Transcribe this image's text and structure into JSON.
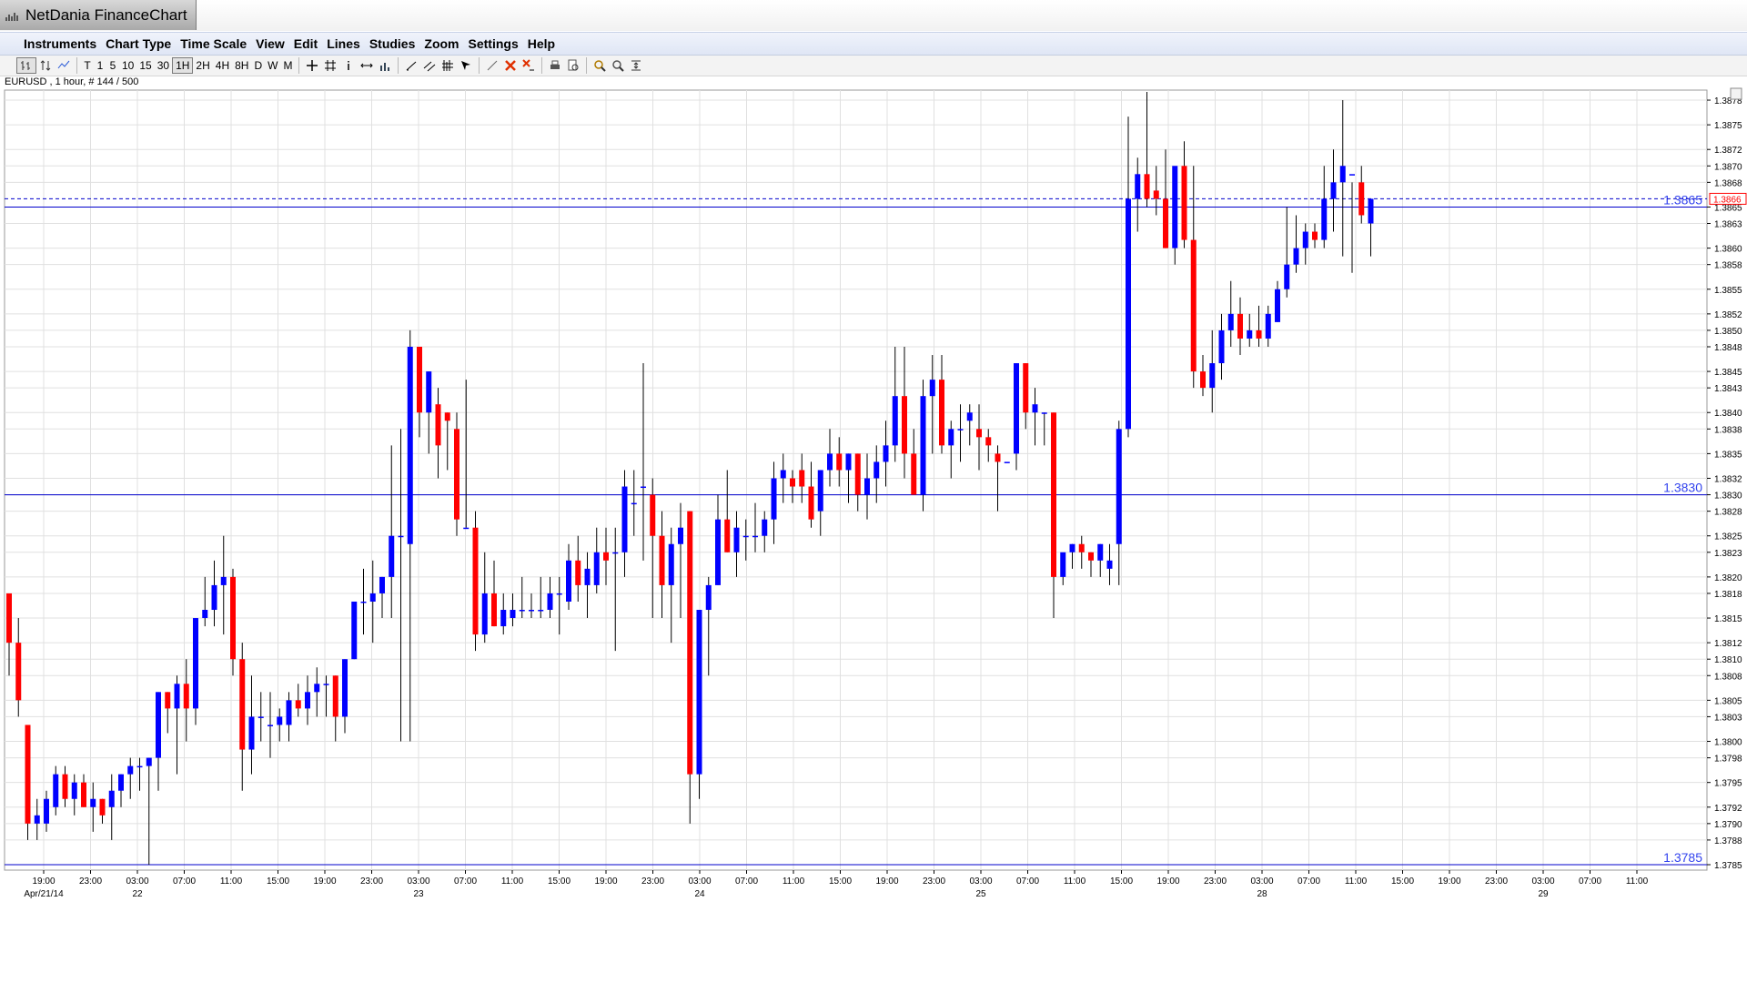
{
  "window": {
    "title": "NetDania FinanceChart"
  },
  "menu": [
    "Instruments",
    "Chart Type",
    "Time Scale",
    "View",
    "Edit",
    "Lines",
    "Studies",
    "Zoom",
    "Settings",
    "Help"
  ],
  "toolbar": {
    "timescales": [
      "T",
      "1",
      "5",
      "10",
      "15",
      "30",
      "1H",
      "2H",
      "4H",
      "8H",
      "D",
      "W",
      "M"
    ],
    "selected_timescale": "1H",
    "icons": [
      "bar-chart-icon",
      "sort-icon",
      "line-chart-icon",
      "crosshair-icon",
      "grid-icon",
      "info-icon",
      "pan-icon",
      "volume-icon",
      "trendline-icon",
      "trend-channel-icon",
      "fibonacci-icon",
      "arrow-cursor-icon",
      "draw-line-icon",
      "delete-icon",
      "delete-all-icon",
      "print-icon",
      "print-preview-icon",
      "zoom-in-icon",
      "zoom-out-icon",
      "zoom-fit-icon"
    ]
  },
  "chart_caption": "EURUSD , 1 hour, # 144 / 500",
  "colors": {
    "bull": "#0000ff",
    "bear": "#ff0000",
    "wick": "#000000",
    "grid": "#e0e0e0",
    "hline": "#0000cc",
    "dashed": "#0000cc",
    "price_box": "#ff0000"
  },
  "chart_data": {
    "type": "candlestick",
    "symbol": "EURUSD",
    "interval": "1 hour",
    "ylim": [
      1.3785,
      1.388
    ],
    "y_ticks": [
      "1.3878",
      "1.3875",
      "1.3872",
      "1.3870",
      "1.3868",
      "1.3865",
      "1.3863",
      "1.3860",
      "1.3858",
      "1.3855",
      "1.3852",
      "1.3850",
      "1.3848",
      "1.3845",
      "1.3843",
      "1.3840",
      "1.3838",
      "1.3835",
      "1.3832",
      "1.3830",
      "1.3828",
      "1.3825",
      "1.3823",
      "1.3820",
      "1.3818",
      "1.3815",
      "1.3812",
      "1.3810",
      "1.3808",
      "1.3805",
      "1.3803",
      "1.3800",
      "1.3798",
      "1.3795",
      "1.3792",
      "1.3790",
      "1.3788",
      "1.3785"
    ],
    "x_time_labels": [
      "19:00",
      "23:00",
      "03:00",
      "07:00",
      "11:00",
      "15:00",
      "19:00",
      "23:00",
      "03:00",
      "07:00",
      "11:00",
      "15:00",
      "19:00",
      "23:00",
      "03:00",
      "07:00",
      "11:00",
      "15:00",
      "19:00",
      "23:00",
      "03:00",
      "07:00",
      "11:00",
      "15:00",
      "19:00",
      "23:00",
      "03:00",
      "07:00",
      "11:00",
      "15:00",
      "19:00",
      "23:00",
      "03:00",
      "07:00",
      "11:00"
    ],
    "x_date_labels": [
      {
        "label": "Apr/21/14",
        "at_time_index": 0
      },
      {
        "label": "22",
        "at_time_index": 2
      },
      {
        "label": "23",
        "at_time_index": 8
      },
      {
        "label": "24",
        "at_time_index": 14
      },
      {
        "label": "25",
        "at_time_index": 20
      },
      {
        "label": "28",
        "at_time_index": 26
      },
      {
        "label": "29",
        "at_time_index": 32
      }
    ],
    "horizontal_lines": [
      {
        "label": "1.3865",
        "value": 1.3865
      },
      {
        "label": "1.3830",
        "value": 1.383
      },
      {
        "label": "1.3785",
        "value": 1.3785
      }
    ],
    "current_price": {
      "label": "1.3866",
      "value": 1.3866
    },
    "candles": [
      [
        1.3818,
        1.3818,
        1.3808,
        1.3812
      ],
      [
        1.3812,
        1.3815,
        1.3803,
        1.3805
      ],
      [
        1.3802,
        1.3802,
        1.3788,
        1.379
      ],
      [
        1.379,
        1.3793,
        1.3788,
        1.3791
      ],
      [
        1.379,
        1.3794,
        1.3789,
        1.3793
      ],
      [
        1.3792,
        1.3797,
        1.3791,
        1.3796
      ],
      [
        1.3796,
        1.3797,
        1.3792,
        1.3793
      ],
      [
        1.3793,
        1.3796,
        1.3791,
        1.3795
      ],
      [
        1.3795,
        1.3796,
        1.3792,
        1.3792
      ],
      [
        1.3792,
        1.3795,
        1.3789,
        1.3793
      ],
      [
        1.3793,
        1.3793,
        1.379,
        1.3791
      ],
      [
        1.3792,
        1.3796,
        1.3788,
        1.3794
      ],
      [
        1.3794,
        1.3796,
        1.3792,
        1.3796
      ],
      [
        1.3796,
        1.3798,
        1.3793,
        1.3797
      ],
      [
        1.3797,
        1.3798,
        1.3794,
        1.3797
      ],
      [
        1.3797,
        1.3798,
        1.3785,
        1.3798
      ],
      [
        1.3798,
        1.3806,
        1.3794,
        1.3806
      ],
      [
        1.3806,
        1.3806,
        1.3801,
        1.3804
      ],
      [
        1.3804,
        1.3808,
        1.3796,
        1.3807
      ],
      [
        1.3807,
        1.381,
        1.38,
        1.3804
      ],
      [
        1.3804,
        1.3815,
        1.3802,
        1.3815
      ],
      [
        1.3815,
        1.382,
        1.3814,
        1.3816
      ],
      [
        1.3816,
        1.3822,
        1.3814,
        1.3819
      ],
      [
        1.3819,
        1.3825,
        1.3813,
        1.382
      ],
      [
        1.382,
        1.3821,
        1.3808,
        1.381
      ],
      [
        1.381,
        1.3812,
        1.3794,
        1.3799
      ],
      [
        1.3799,
        1.3808,
        1.3796,
        1.3803
      ],
      [
        1.3803,
        1.3806,
        1.38,
        1.3803
      ],
      [
        1.3802,
        1.3806,
        1.3798,
        1.3802
      ],
      [
        1.3802,
        1.3804,
        1.38,
        1.3803
      ],
      [
        1.3802,
        1.3806,
        1.38,
        1.3805
      ],
      [
        1.3805,
        1.3807,
        1.3803,
        1.3804
      ],
      [
        1.3804,
        1.3808,
        1.3802,
        1.3806
      ],
      [
        1.3806,
        1.3809,
        1.3803,
        1.3807
      ],
      [
        1.3807,
        1.3808,
        1.3803,
        1.3807
      ],
      [
        1.3808,
        1.3808,
        1.38,
        1.3803
      ],
      [
        1.3803,
        1.381,
        1.3801,
        1.381
      ],
      [
        1.381,
        1.3816,
        1.381,
        1.3817
      ],
      [
        1.3817,
        1.3821,
        1.3813,
        1.3817
      ],
      [
        1.3817,
        1.3822,
        1.3812,
        1.3818
      ],
      [
        1.3818,
        1.382,
        1.3815,
        1.382
      ],
      [
        1.382,
        1.3836,
        1.3815,
        1.3825
      ],
      [
        1.3825,
        1.3838,
        1.38,
        1.3825
      ],
      [
        1.3824,
        1.385,
        1.38,
        1.3848
      ],
      [
        1.3848,
        1.3847,
        1.3837,
        1.384
      ],
      [
        1.384,
        1.3845,
        1.3835,
        1.3845
      ],
      [
        1.3841,
        1.3843,
        1.3832,
        1.3836
      ],
      [
        1.384,
        1.384,
        1.3833,
        1.3839
      ],
      [
        1.3838,
        1.384,
        1.3825,
        1.3827
      ],
      [
        1.3826,
        1.3844,
        1.3826,
        1.3826
      ],
      [
        1.3826,
        1.3828,
        1.3811,
        1.3813
      ],
      [
        1.3813,
        1.3823,
        1.3812,
        1.3818
      ],
      [
        1.3818,
        1.3822,
        1.3814,
        1.3814
      ],
      [
        1.3814,
        1.3818,
        1.3813,
        1.3816
      ],
      [
        1.3815,
        1.3818,
        1.3814,
        1.3816
      ],
      [
        1.3816,
        1.382,
        1.3815,
        1.3816
      ],
      [
        1.3816,
        1.3818,
        1.3815,
        1.3816
      ],
      [
        1.3816,
        1.382,
        1.3815,
        1.3816
      ],
      [
        1.3816,
        1.382,
        1.3815,
        1.3818
      ],
      [
        1.3818,
        1.382,
        1.3813,
        1.3818
      ],
      [
        1.3817,
        1.3824,
        1.3816,
        1.3822
      ],
      [
        1.3822,
        1.3825,
        1.3817,
        1.3819
      ],
      [
        1.3819,
        1.3823,
        1.3815,
        1.3821
      ],
      [
        1.3819,
        1.3826,
        1.3818,
        1.3823
      ],
      [
        1.3823,
        1.3826,
        1.3819,
        1.3822
      ],
      [
        1.3823,
        1.3826,
        1.3811,
        1.3823
      ],
      [
        1.3823,
        1.3833,
        1.382,
        1.3831
      ],
      [
        1.3829,
        1.3833,
        1.3825,
        1.3829
      ],
      [
        1.3831,
        1.3846,
        1.3822,
        1.3831
      ],
      [
        1.383,
        1.3832,
        1.3815,
        1.3825
      ],
      [
        1.3825,
        1.3828,
        1.3815,
        1.3819
      ],
      [
        1.3819,
        1.3826,
        1.3812,
        1.3824
      ],
      [
        1.3824,
        1.3829,
        1.3815,
        1.3826
      ],
      [
        1.3828,
        1.3828,
        1.379,
        1.3796
      ],
      [
        1.3796,
        1.3816,
        1.3793,
        1.3816
      ],
      [
        1.3816,
        1.382,
        1.3808,
        1.3819
      ],
      [
        1.3819,
        1.383,
        1.3819,
        1.3827
      ],
      [
        1.3827,
        1.3833,
        1.3823,
        1.3823
      ],
      [
        1.3823,
        1.3828,
        1.382,
        1.3826
      ],
      [
        1.3825,
        1.3827,
        1.3822,
        1.3825
      ],
      [
        1.3825,
        1.3829,
        1.3823,
        1.3825
      ],
      [
        1.3825,
        1.3828,
        1.3823,
        1.3827
      ],
      [
        1.3827,
        1.3834,
        1.3824,
        1.3832
      ],
      [
        1.3832,
        1.3835,
        1.3829,
        1.3833
      ],
      [
        1.3832,
        1.3833,
        1.3829,
        1.3831
      ],
      [
        1.3833,
        1.3835,
        1.3829,
        1.3831
      ],
      [
        1.3831,
        1.3834,
        1.3826,
        1.3827
      ],
      [
        1.3828,
        1.3833,
        1.3825,
        1.3833
      ],
      [
        1.3833,
        1.3838,
        1.3831,
        1.3835
      ],
      [
        1.3835,
        1.3837,
        1.3831,
        1.3833
      ],
      [
        1.3833,
        1.3835,
        1.3829,
        1.3835
      ],
      [
        1.3835,
        1.3835,
        1.3828,
        1.383
      ],
      [
        1.383,
        1.3835,
        1.3827,
        1.3832
      ],
      [
        1.3832,
        1.3836,
        1.3829,
        1.3834
      ],
      [
        1.3834,
        1.3839,
        1.3831,
        1.3836
      ],
      [
        1.3836,
        1.3848,
        1.3834,
        1.3842
      ],
      [
        1.3842,
        1.3848,
        1.3832,
        1.3835
      ],
      [
        1.3835,
        1.3838,
        1.383,
        1.383
      ],
      [
        1.383,
        1.3844,
        1.3828,
        1.3842
      ],
      [
        1.3842,
        1.3847,
        1.3835,
        1.3844
      ],
      [
        1.3844,
        1.3847,
        1.3835,
        1.3836
      ],
      [
        1.3836,
        1.3839,
        1.3832,
        1.3838
      ],
      [
        1.3838,
        1.3841,
        1.3834,
        1.3838
      ],
      [
        1.3839,
        1.3841,
        1.3836,
        1.384
      ],
      [
        1.3838,
        1.3841,
        1.3833,
        1.3837
      ],
      [
        1.3837,
        1.3838,
        1.3834,
        1.3836
      ],
      [
        1.3835,
        1.3836,
        1.3828,
        1.3834
      ],
      [
        1.3834,
        1.3834,
        1.3834,
        1.3834
      ],
      [
        1.3835,
        1.3846,
        1.3833,
        1.3846
      ],
      [
        1.3846,
        1.3846,
        1.3838,
        1.384
      ],
      [
        1.384,
        1.3843,
        1.3836,
        1.3841
      ],
      [
        1.384,
        1.384,
        1.3836,
        1.384
      ],
      [
        1.384,
        1.384,
        1.3815,
        1.382
      ],
      [
        1.382,
        1.3822,
        1.3819,
        1.3823
      ],
      [
        1.3823,
        1.3824,
        1.3821,
        1.3824
      ],
      [
        1.3824,
        1.3825,
        1.3821,
        1.3823
      ],
      [
        1.3823,
        1.3823,
        1.382,
        1.3822
      ],
      [
        1.3822,
        1.3824,
        1.382,
        1.3824
      ],
      [
        1.3821,
        1.3824,
        1.3819,
        1.3822
      ],
      [
        1.3824,
        1.3839,
        1.3819,
        1.3838
      ],
      [
        1.3838,
        1.3876,
        1.3837,
        1.3866
      ],
      [
        1.3866,
        1.3871,
        1.3862,
        1.3869
      ],
      [
        1.3869,
        1.3879,
        1.3865,
        1.3866
      ],
      [
        1.3867,
        1.387,
        1.3864,
        1.3866
      ],
      [
        1.3866,
        1.3872,
        1.386,
        1.386
      ],
      [
        1.386,
        1.3869,
        1.3858,
        1.387
      ],
      [
        1.387,
        1.3873,
        1.386,
        1.3861
      ],
      [
        1.3861,
        1.387,
        1.3843,
        1.3845
      ],
      [
        1.3845,
        1.3847,
        1.3842,
        1.3843
      ],
      [
        1.3843,
        1.385,
        1.384,
        1.3846
      ],
      [
        1.3846,
        1.3852,
        1.3844,
        1.385
      ],
      [
        1.385,
        1.3856,
        1.3848,
        1.3852
      ],
      [
        1.3852,
        1.3854,
        1.3847,
        1.3849
      ],
      [
        1.3849,
        1.3852,
        1.3848,
        1.385
      ],
      [
        1.385,
        1.3853,
        1.3848,
        1.3849
      ],
      [
        1.3849,
        1.3853,
        1.3848,
        1.3852
      ],
      [
        1.3851,
        1.3856,
        1.3851,
        1.3855
      ],
      [
        1.3855,
        1.3865,
        1.3854,
        1.3858
      ],
      [
        1.3858,
        1.3864,
        1.3857,
        1.386
      ],
      [
        1.386,
        1.3863,
        1.3858,
        1.3862
      ],
      [
        1.3862,
        1.3863,
        1.386,
        1.3861
      ],
      [
        1.3861,
        1.387,
        1.386,
        1.3866
      ],
      [
        1.3866,
        1.3872,
        1.3862,
        1.3868
      ],
      [
        1.3868,
        1.3878,
        1.3859,
        1.387
      ],
      [
        1.3869,
        1.3868,
        1.3857,
        1.3869
      ],
      [
        1.3868,
        1.387,
        1.3863,
        1.3864
      ],
      [
        1.3863,
        1.3866,
        1.3859,
        1.3866
      ]
    ]
  }
}
